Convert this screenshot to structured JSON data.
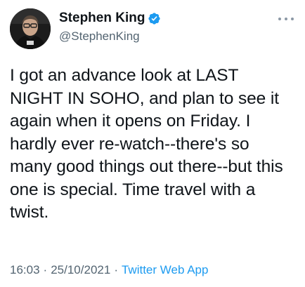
{
  "author": {
    "display_name": "Stephen King",
    "handle": "@StephenKing",
    "verified": true,
    "verified_color": "#1d9bf0"
  },
  "tweet": {
    "text": "I got an advance look at LAST\nNIGHT IN SOHO, and plan to see it\nagain when it opens on Friday. I\nhardly ever re-watch--there's so\nmany good things out there--but this\none is special. Time travel with a\ntwist."
  },
  "meta": {
    "time": "16:03",
    "separator": "·",
    "date": "25/10/2021",
    "source": "Twitter Web App"
  },
  "icons": {
    "more": "more-icon",
    "verified": "verified-badge-icon"
  },
  "colors": {
    "text": "#0f1419",
    "secondary": "#536471",
    "link": "#1d9bf0"
  }
}
